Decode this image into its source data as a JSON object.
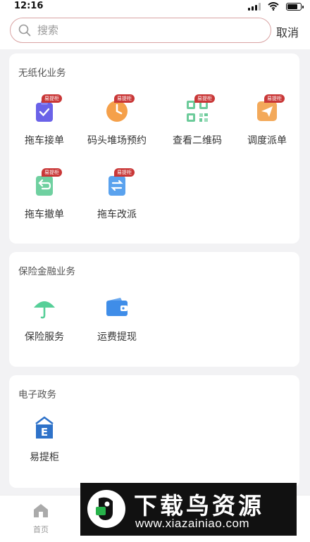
{
  "status_bar": {
    "time": "12:16"
  },
  "search": {
    "placeholder": "搜索",
    "cancel_label": "取消"
  },
  "sections": [
    {
      "title": "无纸化业务",
      "items": [
        {
          "label": "拖车接单",
          "badge": "易提柜",
          "icon": "clipboard-check-icon",
          "color": "#6a62e8"
        },
        {
          "label": "码头堆场预约",
          "badge": "易提柜",
          "icon": "clock-icon",
          "color": "#f5a04a"
        },
        {
          "label": "查看二维码",
          "badge": "易提柜",
          "icon": "qr-code-icon",
          "color": "#6ccb9a"
        },
        {
          "label": "调度派单",
          "badge": "易提柜",
          "icon": "paper-plane-icon",
          "color": "#f3a95a"
        },
        {
          "label": "拖车撤单",
          "badge": "易提柜",
          "icon": "undo-document-icon",
          "color": "#6fd0a0"
        },
        {
          "label": "拖车改派",
          "badge": "易提柜",
          "icon": "swap-document-icon",
          "color": "#5aa2ee"
        }
      ]
    },
    {
      "title": "保险金融业务",
      "items": [
        {
          "label": "保险服务",
          "icon": "umbrella-icon",
          "color": "#56cf98"
        },
        {
          "label": "运费提现",
          "icon": "wallet-icon",
          "color": "#3f8de8"
        }
      ]
    },
    {
      "title": "电子政务",
      "items": [
        {
          "label": "易提柜",
          "icon": "e-box-icon",
          "color": "#2e72c9"
        }
      ]
    }
  ],
  "bottom_nav": {
    "home_label": "首页"
  },
  "watermark": {
    "title": "下载鸟资源",
    "url": "www.xiazainiao.com"
  }
}
